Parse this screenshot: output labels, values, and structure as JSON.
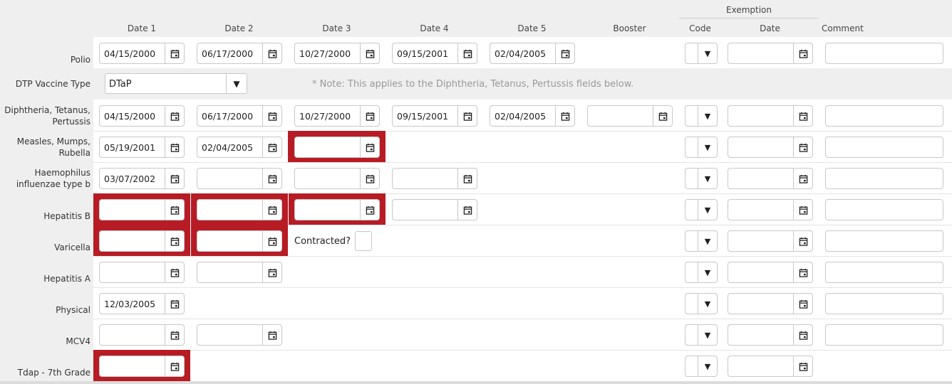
{
  "header": {
    "date1": "Date 1",
    "date2": "Date 2",
    "date3": "Date 3",
    "date4": "Date 4",
    "date5": "Date 5",
    "booster": "Booster",
    "exemption": "Exemption",
    "code": "Code",
    "exdate": "Date",
    "comment": "Comment"
  },
  "dtp": {
    "label": "DTP Vaccine Type",
    "value": "DTaP",
    "note": "* Note: This applies to the Diphtheria, Tetanus, Pertussis fields below."
  },
  "rows": {
    "polio": {
      "label": "Polio",
      "d1": "04/15/2000",
      "d2": "06/17/2000",
      "d3": "10/27/2000",
      "d4": "09/15/2001",
      "d5": "02/04/2005"
    },
    "dtp": {
      "label_l1": "Diphtheria, Tetanus,",
      "label_l2": "Pertussis",
      "d1": "04/15/2000",
      "d2": "06/17/2000",
      "d3": "10/27/2000",
      "d4": "09/15/2001",
      "d5": "02/04/2005",
      "booster": ""
    },
    "mmr": {
      "label_l1": "Measles, Mumps,",
      "label_l2": "Rubella",
      "d1": "05/19/2001",
      "d2": "02/04/2005",
      "d3": ""
    },
    "hib": {
      "label_l1": "Haemophilus",
      "label_l2": "influenzae type b",
      "d1": "03/07/2002",
      "d2": "",
      "d3": "",
      "d4": ""
    },
    "hepb": {
      "label": "Hepatitis B",
      "d1": "",
      "d2": "",
      "d3": "",
      "d4": ""
    },
    "varicella": {
      "label": "Varicella",
      "d1": "",
      "d2": "",
      "contracted": "Contracted?"
    },
    "hepa": {
      "label": "Hepatitis A",
      "d1": "",
      "d2": ""
    },
    "physical": {
      "label": "Physical",
      "d1": "12/03/2005"
    },
    "mcv4": {
      "label": "MCV4",
      "d1": "",
      "d2": ""
    },
    "tdap": {
      "label": "Tdap - 7th Grade",
      "d1": ""
    }
  },
  "colors": {
    "required_highlight": "#b71c25",
    "header_bg": "#efefef",
    "note_text": "#999999"
  },
  "icons": {
    "date_picker": "calendar-icon",
    "dropdown": "chevron-down-icon"
  }
}
